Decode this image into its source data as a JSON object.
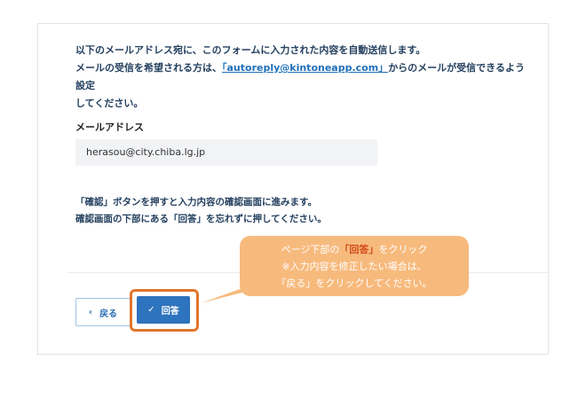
{
  "notice": {
    "line1": "以下のメールアドレス宛に、このフォームに入力された内容を自動送信します。",
    "line2_prefix": "メールの受信を希望される方は、",
    "line2_link": "「autoreply@kintoneapp.com」",
    "line2_suffix": "からのメールが受信できるよう設定",
    "line3": "してください。"
  },
  "email_field": {
    "label": "メールアドレス",
    "value": "herasou@city.chiba.lg.jp"
  },
  "confirm_notice": {
    "line1": "「確認」ボタンを押すと入力内容の確認画面に進みます。",
    "line2": "確認画面の下部にある「回答」を忘れずに押してください。"
  },
  "buttons": {
    "back_icon": "‹",
    "back_label": "戻る",
    "answer_icon": "✓",
    "answer_label": "回答"
  },
  "callout": {
    "line1_prefix": "ページ下部の",
    "line1_highlight": "「回答」",
    "line1_suffix": "をクリック",
    "line2": "※入力内容を修正したい場合は、",
    "line3": "「戻る」をクリックしてください。"
  },
  "colors": {
    "accent": "#2e73bd",
    "highlight_border": "#e0762b",
    "callout_bg": "#f7ba7d",
    "callout_highlight": "#d24a17"
  }
}
